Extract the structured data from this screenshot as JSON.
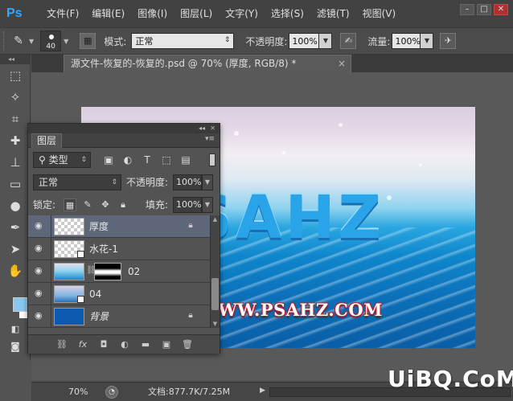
{
  "app": {
    "logo": "Ps"
  },
  "menu": [
    "文件(F)",
    "编辑(E)",
    "图像(I)",
    "图层(L)",
    "文字(Y)",
    "选择(S)",
    "滤镜(T)",
    "视图(V)"
  ],
  "window_controls": {
    "minimize": "–",
    "maximize": "□",
    "close": "✕"
  },
  "options": {
    "brush_size": "40",
    "mode_label": "模式:",
    "mode_value": "正常",
    "opacity_label": "不透明度:",
    "opacity_value": "100%",
    "flow_label": "流量:",
    "flow_value": "100%"
  },
  "document": {
    "tab_title": "源文件-恢复的-恢复的.psd @ 70% (厚度, RGB/8) *",
    "close": "×"
  },
  "canvas": {
    "headline": "SAHZ",
    "site": "WWW.PSAHZ.COM"
  },
  "layers_panel": {
    "tab": "图层",
    "filter_kind": "类型",
    "blend_mode": "正常",
    "opacity_label": "不透明度:",
    "opacity_value": "100%",
    "lock_label": "锁定:",
    "fill_label": "填充:",
    "fill_value": "100%",
    "layers": [
      {
        "name": "厚度",
        "selected": true,
        "locked": true,
        "thumb": "text"
      },
      {
        "name": "水花-1",
        "selected": false,
        "locked": false,
        "thumb": "checker"
      },
      {
        "name": "02",
        "selected": false,
        "locked": false,
        "thumb": "photo",
        "has_mask": true
      },
      {
        "name": "04",
        "selected": false,
        "locked": false,
        "thumb": "mixed"
      },
      {
        "name": "背景",
        "selected": false,
        "locked": true,
        "thumb": "bg"
      }
    ]
  },
  "status": {
    "zoom": "70%",
    "doc_info": "文档:877.7K/7.25M"
  },
  "watermark": "UiBQ.CoM",
  "colors": {
    "foreground": "#89c8ee",
    "background": "#ffffff",
    "selected_layer": "#5d6779"
  }
}
